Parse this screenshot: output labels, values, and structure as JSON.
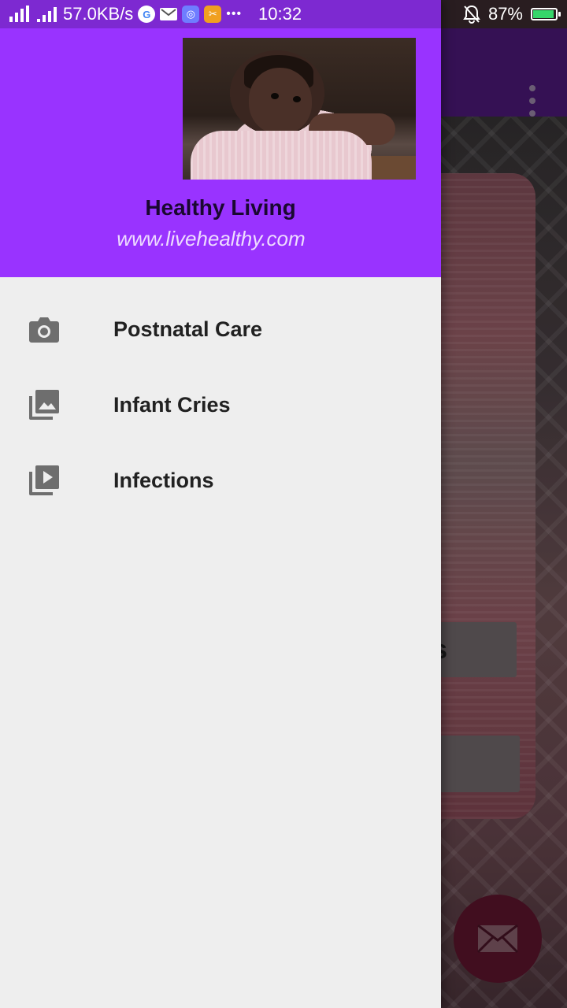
{
  "status_bar": {
    "network_speed": "57.0KB/s",
    "time": "10:32",
    "more_indicator": "•••",
    "battery_percent": "87%",
    "battery_level": 0.87,
    "icons": [
      "signal-icon",
      "signal-icon",
      "google-icon",
      "gmail-icon",
      "vpn-icon",
      "tools-icon",
      "alarm-off-icon",
      "battery-charging-icon"
    ]
  },
  "drawer": {
    "header": {
      "title": "Healthy Living",
      "subtitle": "www.livehealthy.com",
      "background_color": "#9933ff"
    },
    "items": [
      {
        "label": "Postnatal Care",
        "icon": "camera-icon"
      },
      {
        "label": "Infant Cries",
        "icon": "gallery-icon"
      },
      {
        "label": "Infections",
        "icon": "video-library-icon"
      }
    ]
  },
  "background_app": {
    "overflow_menu_icon": "more-vert-icon",
    "partial_button_text": "s",
    "fab_icon": "email-icon"
  }
}
